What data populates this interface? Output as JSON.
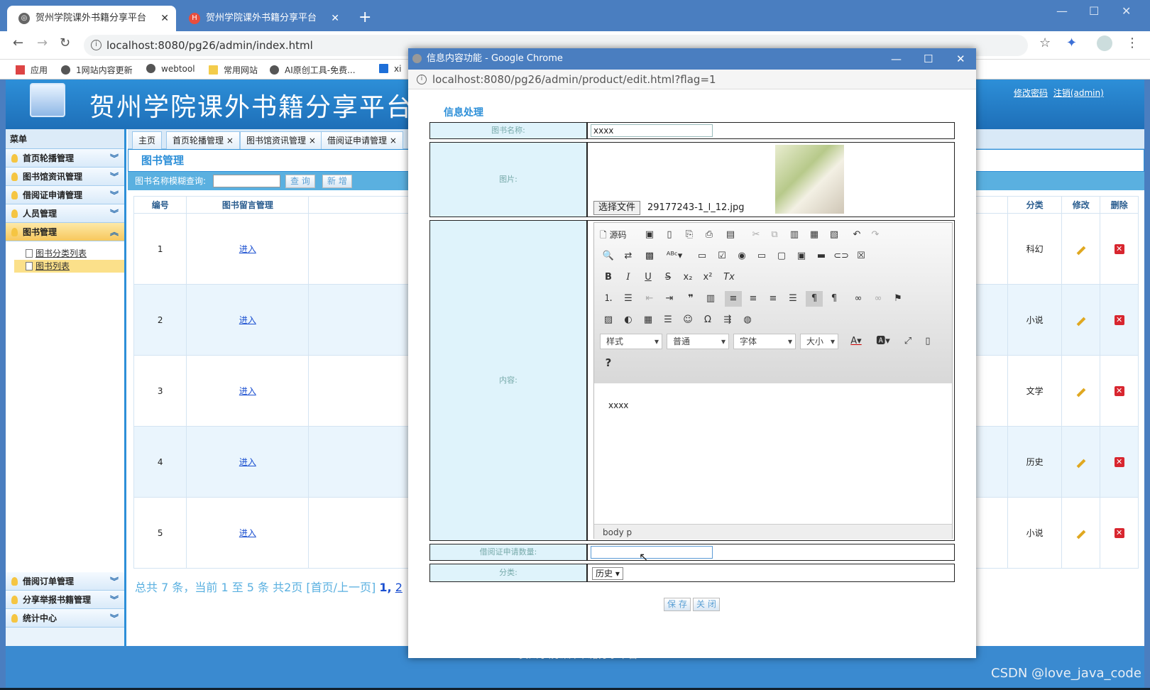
{
  "browser": {
    "tabs": [
      {
        "title": "贺州学院课外书籍分享平台",
        "active": true
      },
      {
        "title": "贺州学院课外书籍分享平台",
        "active": false
      }
    ],
    "url": "localhost:8080/pg26/admin/index.html",
    "bookmarks": [
      "应用",
      "1网站内容更新",
      "webtool",
      "常用网站",
      "AI原创工具-免费...",
      "xi"
    ]
  },
  "site": {
    "title": "贺州学院课外书籍分享平台",
    "header_links": [
      "修改密码",
      "注销(admin)"
    ],
    "footer": "- 贺州学院课外书籍分享平台"
  },
  "sidebar": {
    "heading": "菜单",
    "items_top": [
      "首页轮播管理",
      "图书馆资讯管理",
      "借阅证申请管理",
      "人员管理",
      "图书管理"
    ],
    "sub_items": [
      {
        "label": "图书分类列表",
        "selected": false
      },
      {
        "label": "图书列表",
        "selected": true
      }
    ],
    "items_bottom": [
      "借阅订单管理",
      "分享举报书籍管理",
      "统计中心"
    ]
  },
  "page_tabs": [
    "主页",
    "首页轮播管理",
    "图书馆资讯管理",
    "借阅证申请管理"
  ],
  "content": {
    "title": "图书管理",
    "search_label": "图书名称模糊查询:",
    "search_button": "查 询",
    "add_button": "新 增",
    "columns_left": [
      "编号",
      "图书留言管理"
    ],
    "columns_right": [
      "分类",
      "修改",
      "删除"
    ],
    "rows": [
      {
        "id": "1",
        "link": "进入",
        "category": "科幻"
      },
      {
        "id": "2",
        "link": "进入",
        "category": "小说"
      },
      {
        "id": "3",
        "link": "进入",
        "category": "文学"
      },
      {
        "id": "4",
        "link": "进入",
        "category": "历史"
      },
      {
        "id": "5",
        "link": "进入",
        "category": "小说"
      }
    ],
    "pager": "总共 7 条，当前 1 至 5 条 共2页 [首页/上一页]",
    "pager_current": "1,",
    "pager_next": "2"
  },
  "popup": {
    "window_title": "信息内容功能 - Google Chrome",
    "url": "localhost:8080/pg26/admin/product/edit.html?flag=1",
    "form_title": "信息处理",
    "labels": {
      "name": "图书名称:",
      "image": "图片:",
      "content": "内容:",
      "count": "借阅证申请数量:",
      "category": "分类:"
    },
    "name_value": "xxxx",
    "file_button": "选择文件",
    "file_name": "29177243-1_l_12.jpg",
    "editor": {
      "source_label": "源码",
      "combo_style": "样式",
      "combo_format": "普通",
      "combo_font": "字体",
      "combo_size": "大小",
      "body_text": "xxxx",
      "path": "body  p"
    },
    "count_value": "",
    "category_value": "历史",
    "save_button": "保 存",
    "close_button": "关 闭"
  },
  "watermark": "CSDN @love_java_code"
}
